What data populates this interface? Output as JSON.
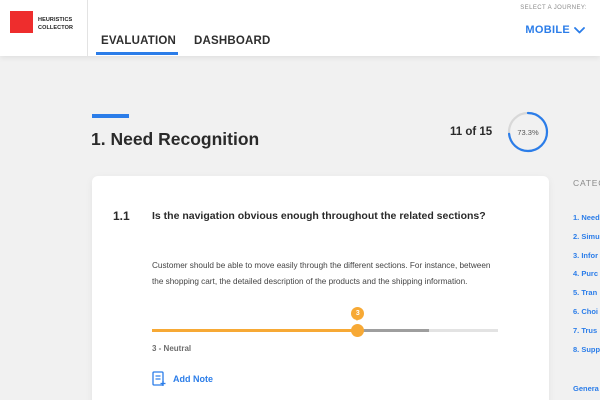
{
  "colors": {
    "accent": "#2b7de9",
    "slider": "#f7a935",
    "logo": "#ee2d2d",
    "ring_track": "#d8d8d8"
  },
  "logo": {
    "line1": "HEURISTICS",
    "line2": "COLLECTOR"
  },
  "tabs": [
    {
      "label": "EVALUATION",
      "active": true
    },
    {
      "label": "DASHBOARD",
      "active": false
    }
  ],
  "journey": {
    "label": "SELECT A JOURNEY:",
    "value": "MOBILE",
    "icon": "chevron-down-icon"
  },
  "section": {
    "title": "1. Need Recognition"
  },
  "progress": {
    "count_text": "11 of 15",
    "percent_text": "73.3%",
    "percent": 73.3
  },
  "question": {
    "number": "1.1",
    "text": "Is the navigation obvious enough throughout the related sections?",
    "description": "Customer should be able to move easily through the different sections. For instance, between the shopping cart, the detailed description of the products and the shipping information."
  },
  "slider": {
    "value": "3",
    "label": "3 - Neutral",
    "fill_fraction": 0.595
  },
  "add_note": {
    "label": "Add Note",
    "icon": "note-add-icon"
  },
  "sidebar": {
    "heading": "CATEG",
    "items": [
      "1. Need",
      "2. Simu",
      "3. Infor",
      "4. Purc",
      "5. Tran",
      "6. Choi",
      "7. Trus",
      "8. Supp",
      "Genera"
    ]
  }
}
